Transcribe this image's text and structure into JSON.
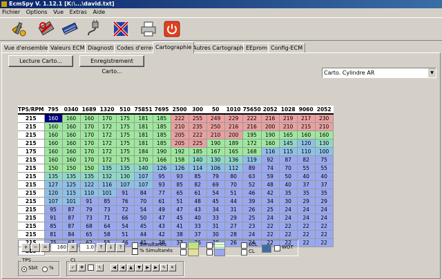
{
  "window": {
    "title": "EcmSpy V. 1.12.1  [K:\\...\\david.txt]"
  },
  "menu": [
    "Fichier",
    "Options",
    "Vue",
    "Extras",
    "Aide"
  ],
  "toolbar": {
    "icons": [
      "tools-icon",
      "ecu-connect-icon",
      "ecu-chip-icon",
      "cable-plug-icon",
      "disconnect-flag-icon",
      "printer-icon",
      "power-icon"
    ]
  },
  "tabs": [
    "Vue d'ensemble",
    "Valeurs ECM",
    "Diagnostic",
    "Codes d'erreur",
    "Cartographie",
    "Autres Cartographies",
    "EEprom",
    "Config-ECM"
  ],
  "active_tab": 4,
  "buttons": {
    "read": "Lecture Carto...",
    "save": "Enregistrement Carto..."
  },
  "map_select": {
    "value": "Carto. Cylindre AR"
  },
  "grid": {
    "corner": "TPS/RPM",
    "columns": [
      "795",
      "0340",
      "1689",
      "1320",
      "510",
      "75851",
      "7695",
      "2500",
      "300",
      "50",
      "1010",
      "75650",
      "2052",
      "1028",
      "9060",
      "2052"
    ],
    "row_headers": [
      "215",
      "215",
      "215",
      "215",
      "175",
      "215",
      "215",
      "215",
      "215",
      "215",
      "215",
      "215",
      "215",
      "215",
      "215",
      "215",
      "215"
    ],
    "rows": [
      [
        160,
        160,
        160,
        170,
        175,
        181,
        185,
        222,
        255,
        249,
        229,
        222,
        216,
        219,
        217,
        230
      ],
      [
        160,
        160,
        170,
        172,
        175,
        181,
        185,
        210,
        235,
        250,
        216,
        216,
        200,
        210,
        215,
        210
      ],
      [
        160,
        160,
        170,
        172,
        175,
        181,
        185,
        205,
        222,
        210,
        200,
        195,
        190,
        165,
        160,
        160
      ],
      [
        160,
        160,
        170,
        172,
        175,
        181,
        185,
        205,
        225,
        190,
        189,
        172,
        160,
        145,
        120,
        130
      ],
      [
        160,
        160,
        170,
        172,
        175,
        184,
        190,
        192,
        185,
        167,
        165,
        168,
        116,
        115,
        110,
        100
      ],
      [
        160,
        160,
        170,
        172,
        175,
        170,
        166,
        158,
        140,
        130,
        136,
        119,
        92,
        87,
        82,
        75
      ],
      [
        150,
        150,
        150,
        135,
        135,
        140,
        126,
        126,
        114,
        106,
        112,
        89,
        74,
        70,
        55,
        55
      ],
      [
        135,
        135,
        135,
        132,
        130,
        107,
        95,
        93,
        85,
        79,
        80,
        63,
        59,
        50,
        40,
        40
      ],
      [
        127,
        125,
        122,
        116,
        107,
        107,
        93,
        85,
        82,
        69,
        70,
        52,
        48,
        40,
        37,
        37
      ],
      [
        120,
        115,
        110,
        101,
        91,
        84,
        77,
        65,
        61,
        54,
        51,
        46,
        42,
        35,
        35,
        35
      ],
      [
        107,
        101,
        91,
        85,
        76,
        70,
        61,
        51,
        48,
        45,
        44,
        39,
        34,
        30,
        29,
        29
      ],
      [
        95,
        87,
        79,
        73,
        72,
        54,
        49,
        47,
        43,
        34,
        31,
        26,
        25,
        24,
        24,
        24
      ],
      [
        91,
        87,
        73,
        71,
        66,
        50,
        47,
        45,
        40,
        33,
        29,
        25,
        24,
        24,
        24,
        24
      ],
      [
        85,
        87,
        68,
        64,
        54,
        45,
        43,
        41,
        33,
        31,
        27,
        23,
        22,
        22,
        22,
        22
      ],
      [
        81,
        84,
        65,
        58,
        51,
        44,
        42,
        38,
        37,
        30,
        28,
        24,
        22,
        22,
        22,
        22
      ],
      [
        75,
        67,
        62,
        55,
        46,
        41,
        38,
        37,
        36,
        30,
        26,
        24,
        22,
        22,
        22,
        22
      ]
    ],
    "selected_cell": [
      0,
      0
    ]
  },
  "controls": {
    "step_value": "160",
    "factor_value": "1.0",
    "simultanes_label": "Simultanés",
    "pct_simultanes_label": "% Simultanés",
    "lcl_label": "LCL",
    "cl_label": "CL",
    "wot_label": "WOT"
  },
  "tps_group": {
    "title": "TPS",
    "options": [
      "Sbit",
      "%"
    ],
    "selected": 0
  },
  "cl_group": {
    "title": "CL"
  },
  "colors": {
    "red": "#e9a0a0",
    "green": "#9ee89e",
    "blue": "#9aa8f0",
    "selection": "#000080"
  }
}
